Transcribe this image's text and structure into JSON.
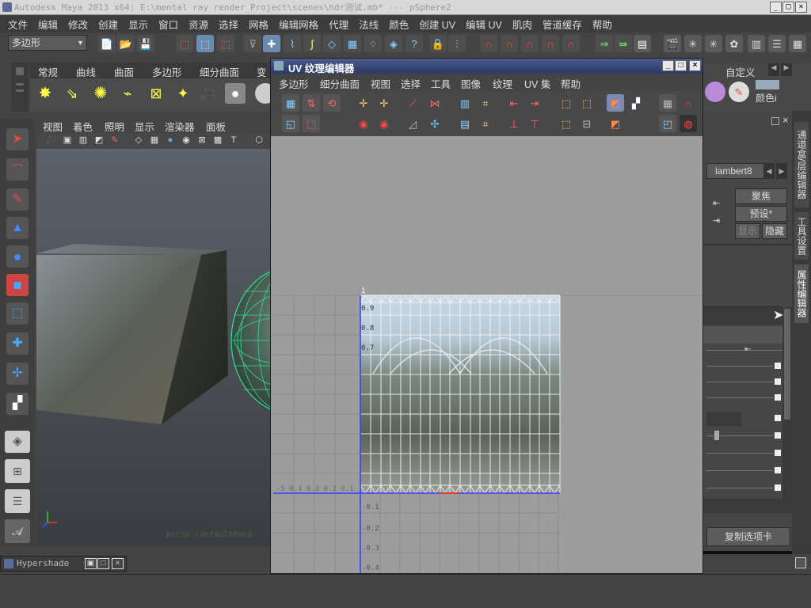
{
  "app": {
    "title": "Autodesk Maya 2013 x64: E:\\mental ray render_Project\\scenes\\hdr测试.mb*   ---   pSphere2"
  },
  "menubar": [
    "文件",
    "编辑",
    "修改",
    "创建",
    "显示",
    "窗口",
    "资源",
    "选择",
    "网格",
    "编辑网格",
    "代理",
    "法线",
    "颜色",
    "创建 UV",
    "编辑 UV",
    "肌肉",
    "管道缓存",
    "帮助"
  ],
  "status_line": {
    "mode": "多边形"
  },
  "shelf": {
    "tabs": [
      "常规",
      "曲线",
      "曲面",
      "多边形",
      "细分曲面",
      "变"
    ],
    "right_tabs": [
      "自定义",
      "颜色i"
    ]
  },
  "viewport": {
    "menu": [
      "视图",
      "着色",
      "照明",
      "显示",
      "渲染器",
      "面板"
    ],
    "camera_label": "persp (defaultRend"
  },
  "uv_editor": {
    "title": "UV 纹理编辑器",
    "menu": [
      "多边形",
      "细分曲面",
      "视图",
      "选择",
      "工具",
      "图像",
      "纹理",
      "UV 集",
      "帮助"
    ],
    "grid_labels_v": [
      "1",
      "0.9",
      "0.8",
      "0.7"
    ],
    "grid_labels_neg": [
      "-0.1",
      "-0.2",
      "-0.3",
      "-0.4"
    ],
    "grid_labels_h": "-5 0.4 0.3 0.2 0.1"
  },
  "right_panel": {
    "material": "lambert8",
    "focus_btn": "聚焦",
    "preset_btn": "预设*",
    "show_btn": "显示",
    "hide_btn": "隐藏",
    "copy_tab_btn": "复制选项卡"
  },
  "side_tabs": [
    "通道盒/层编辑器",
    "工具设置",
    "属性编辑器"
  ],
  "hypershade": {
    "label": "Hypershade"
  },
  "colors": {
    "accent": "#3a4a7a",
    "wire": "#2fe08a",
    "axis_blue": "#3a3aff"
  }
}
